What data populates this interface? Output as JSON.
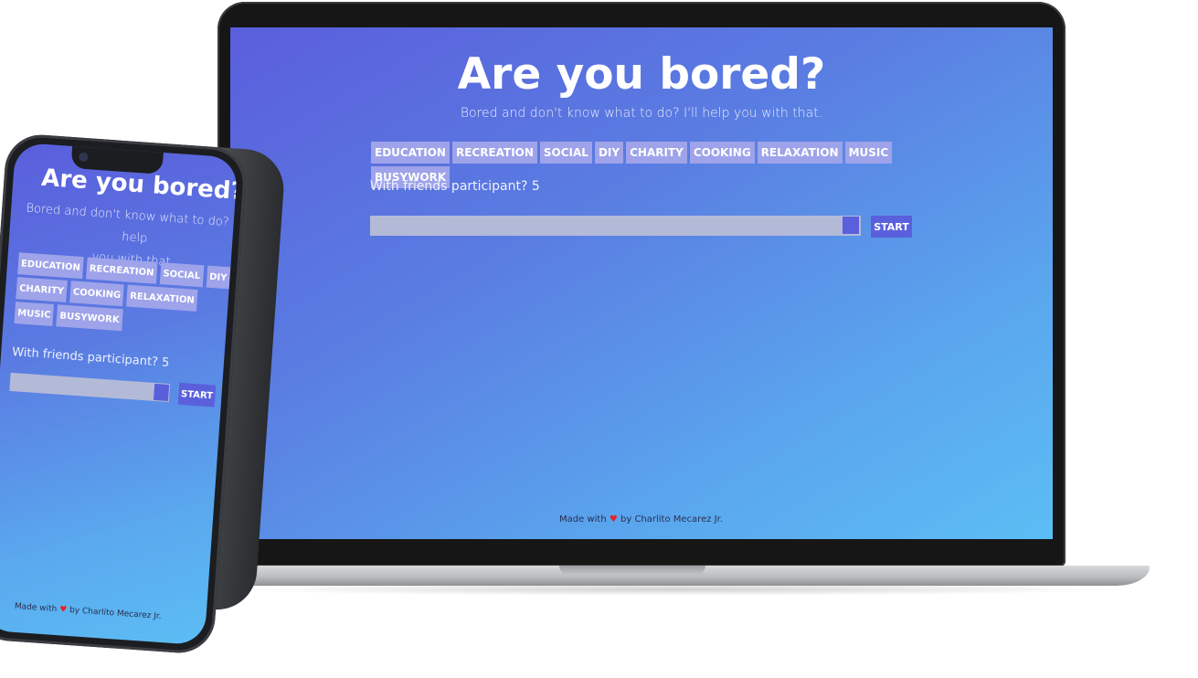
{
  "app": {
    "title": "Are you bored?",
    "subtitle": "Bored and don't know what to do? I'll help you with that.",
    "phone_subtitle_line1": "Bored and don't know what to do? I'll help",
    "phone_subtitle_line2": "you with that.",
    "categories": [
      "EDUCATION",
      "RECREATION",
      "SOCIAL",
      "DIY",
      "CHARITY",
      "COOKING",
      "RELAXATION",
      "MUSIC",
      "BUSYWORK"
    ],
    "participants_label": "With friends participant?",
    "participants_value": "5",
    "start_label": "START",
    "footer_prefix": "Made with",
    "footer_heart": "♥",
    "footer_suffix": "by Charlito Mecarez Jr."
  },
  "colors": {
    "gradient_start": "#5a5edc",
    "gradient_end": "#5cbdf4",
    "chip_bg": "#9ea3ea",
    "button_bg": "#5a60dc",
    "heart": "#e2262a"
  }
}
